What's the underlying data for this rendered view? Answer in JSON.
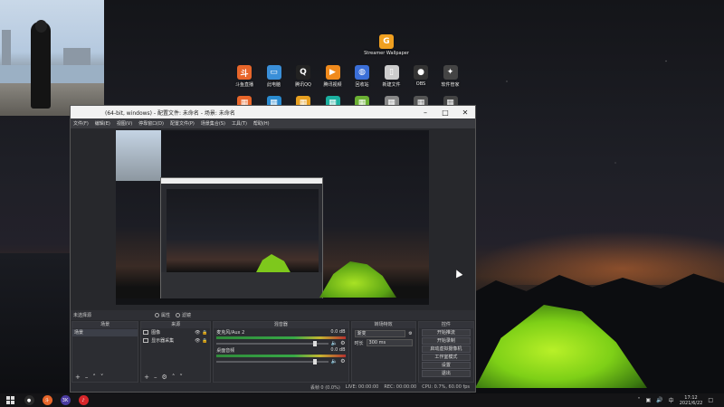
{
  "desktop": {
    "icons_row0": [
      {
        "label": "Streamer Wallpaper",
        "color": "#f0a020",
        "glyph": "G"
      }
    ],
    "icons_row1": [
      {
        "label": "斗鱼直播",
        "color": "#e8662a",
        "glyph": "斗"
      },
      {
        "label": "此电脑",
        "color": "#3a8fd8",
        "glyph": "▭"
      },
      {
        "label": "腾讯QQ",
        "color": "#222222",
        "glyph": "Q"
      },
      {
        "label": "腾讯视频",
        "color": "#f08a1c",
        "glyph": "▶"
      },
      {
        "label": "回收站",
        "color": "#3b6fd8",
        "glyph": "◍"
      },
      {
        "label": "新建文件",
        "color": "#cccccc",
        "glyph": "▯"
      },
      {
        "label": "OBS",
        "color": "#333333",
        "glyph": "●"
      },
      {
        "label": "软件管家",
        "color": "#444444",
        "glyph": "✦"
      }
    ],
    "icons_row2": [
      {
        "label": "",
        "color": "#e8662a",
        "glyph": "▦"
      },
      {
        "label": "",
        "color": "#2a8bd0",
        "glyph": "▦"
      },
      {
        "label": "",
        "color": "#e8a020",
        "glyph": "▦"
      },
      {
        "label": "",
        "color": "#1bb0a0",
        "glyph": "▦"
      },
      {
        "label": "",
        "color": "#6bb033",
        "glyph": "▦"
      },
      {
        "label": "",
        "color": "#888888",
        "glyph": "▦"
      },
      {
        "label": "",
        "color": "#555555",
        "glyph": "▦"
      },
      {
        "label": "",
        "color": "#444444",
        "glyph": "▦"
      }
    ]
  },
  "obs": {
    "title": "(64-bit, windows) - 配置文件: 未命名 - 场景: 未命名",
    "menu": [
      "文件(F)",
      "编辑(E)",
      "视图(V)",
      "停靠窗口(D)",
      "配置文件(P)",
      "场景集合(S)",
      "工具(T)",
      "帮助(H)"
    ],
    "scene_bar": {
      "label": "未选择源",
      "properties": "属性",
      "filters": "滤镜"
    },
    "docks": {
      "scenes": {
        "header": "场景",
        "items": [
          "场景"
        ]
      },
      "sources": {
        "header": "来源",
        "items": [
          {
            "name": "图像",
            "icon": "image-icon"
          },
          {
            "name": "显示器采集",
            "icon": "monitor-icon"
          }
        ]
      },
      "mixer": {
        "header": "混音器",
        "channels": [
          {
            "name": "麦克风/Aux 2",
            "db": "0.0 dB"
          },
          {
            "name": "桌面音频",
            "db": "0.0 dB"
          }
        ]
      },
      "transitions": {
        "header": "转场特效",
        "type": "渐变",
        "duration_label": "时长",
        "duration_value": "300 ms"
      },
      "controls": {
        "header": "控件",
        "buttons": [
          "开始推流",
          "开始录制",
          "启动虚拟摄像机",
          "工作室模式",
          "设置",
          "退出"
        ]
      }
    },
    "status": {
      "live": "LIVE: 00:00:00",
      "rec": "REC: 00:00:00",
      "cpu": "CPU: 0.7%, 60.00 fps",
      "drop": "丢帧 0 (0.0%)"
    }
  },
  "taskbar": {
    "apps": [
      {
        "name": "obs",
        "color": "#2b2b2b",
        "glyph": "●"
      },
      {
        "name": "douyu",
        "color": "#e8662a",
        "glyph": "斗"
      },
      {
        "name": "app3",
        "color": "#4a3aa0",
        "glyph": "3K"
      },
      {
        "name": "netease-music",
        "color": "#d8262a",
        "glyph": "♪"
      }
    ],
    "ime": "中",
    "time": "17:12",
    "date": "2021/6/22"
  }
}
